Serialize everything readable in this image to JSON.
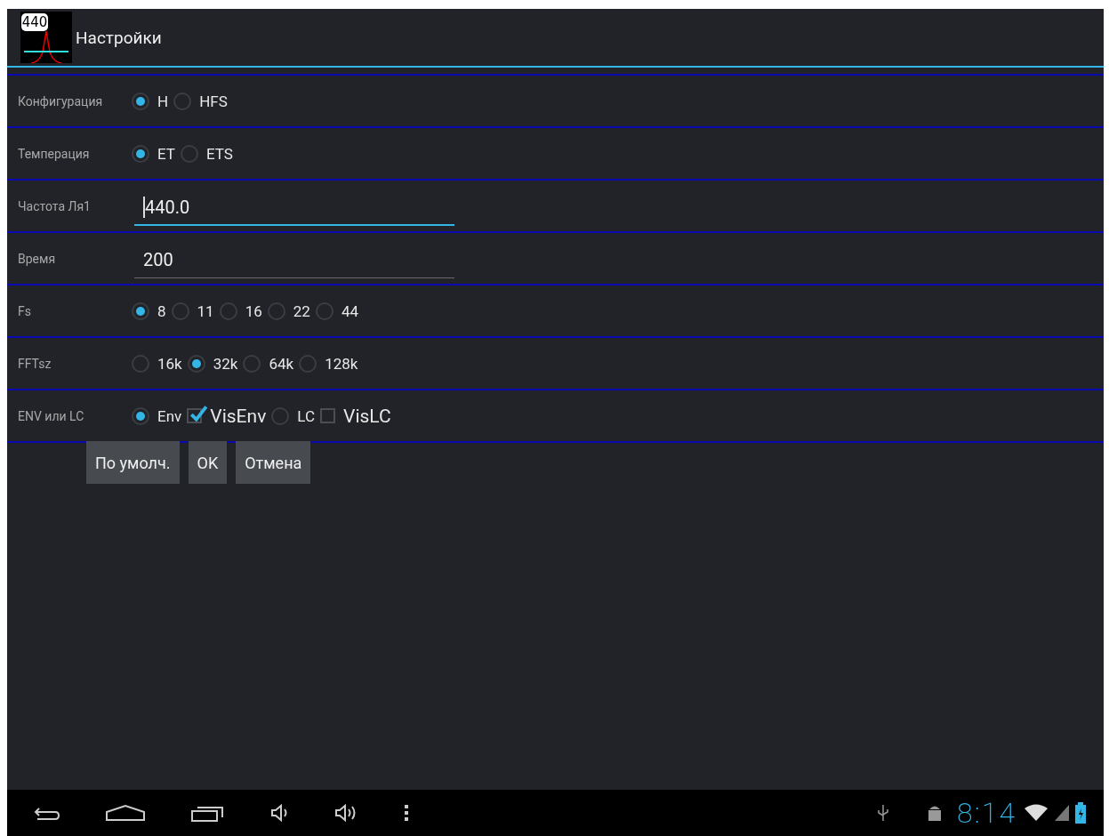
{
  "app_bar": {
    "logo_text": "440",
    "title": "Настройки"
  },
  "rows": [
    {
      "label": "Конфигурация",
      "kind": "options",
      "options": [
        {
          "kind": "radio",
          "label": "H",
          "selected": true
        },
        {
          "kind": "radio",
          "label": "HFS",
          "selected": false
        }
      ]
    },
    {
      "label": "Темперация",
      "kind": "options",
      "options": [
        {
          "kind": "radio",
          "label": "ET",
          "selected": true
        },
        {
          "kind": "radio",
          "label": "ETS",
          "selected": false
        }
      ]
    },
    {
      "label": "Частота Ля1",
      "kind": "field",
      "value": "440.0",
      "focused": true
    },
    {
      "label": "Время",
      "kind": "field",
      "value": "200",
      "focused": false
    },
    {
      "label": "Fs",
      "kind": "options",
      "options": [
        {
          "kind": "radio",
          "label": "8",
          "selected": true
        },
        {
          "kind": "radio",
          "label": "11",
          "selected": false
        },
        {
          "kind": "radio",
          "label": "16",
          "selected": false
        },
        {
          "kind": "radio",
          "label": "22",
          "selected": false
        },
        {
          "kind": "radio",
          "label": "44",
          "selected": false
        }
      ]
    },
    {
      "label": "FFTsz",
      "kind": "options",
      "options": [
        {
          "kind": "radio",
          "label": "16k",
          "selected": false
        },
        {
          "kind": "radio",
          "label": "32k",
          "selected": true
        },
        {
          "kind": "radio",
          "label": "64k",
          "selected": false
        },
        {
          "kind": "radio",
          "label": "128k",
          "selected": false
        }
      ]
    },
    {
      "label": "ENV или LC",
      "kind": "options",
      "options": [
        {
          "kind": "radio",
          "label": "Env",
          "selected": true
        },
        {
          "kind": "checkbox",
          "label": "VisEnv",
          "checked": true
        },
        {
          "kind": "radio",
          "label": "LC",
          "selected": false
        },
        {
          "kind": "checkbox",
          "label": "VisLC",
          "checked": false
        }
      ]
    }
  ],
  "buttons": [
    "По умолч.",
    "OK",
    "Отмена"
  ],
  "status_bar": {
    "time": "8:14"
  }
}
